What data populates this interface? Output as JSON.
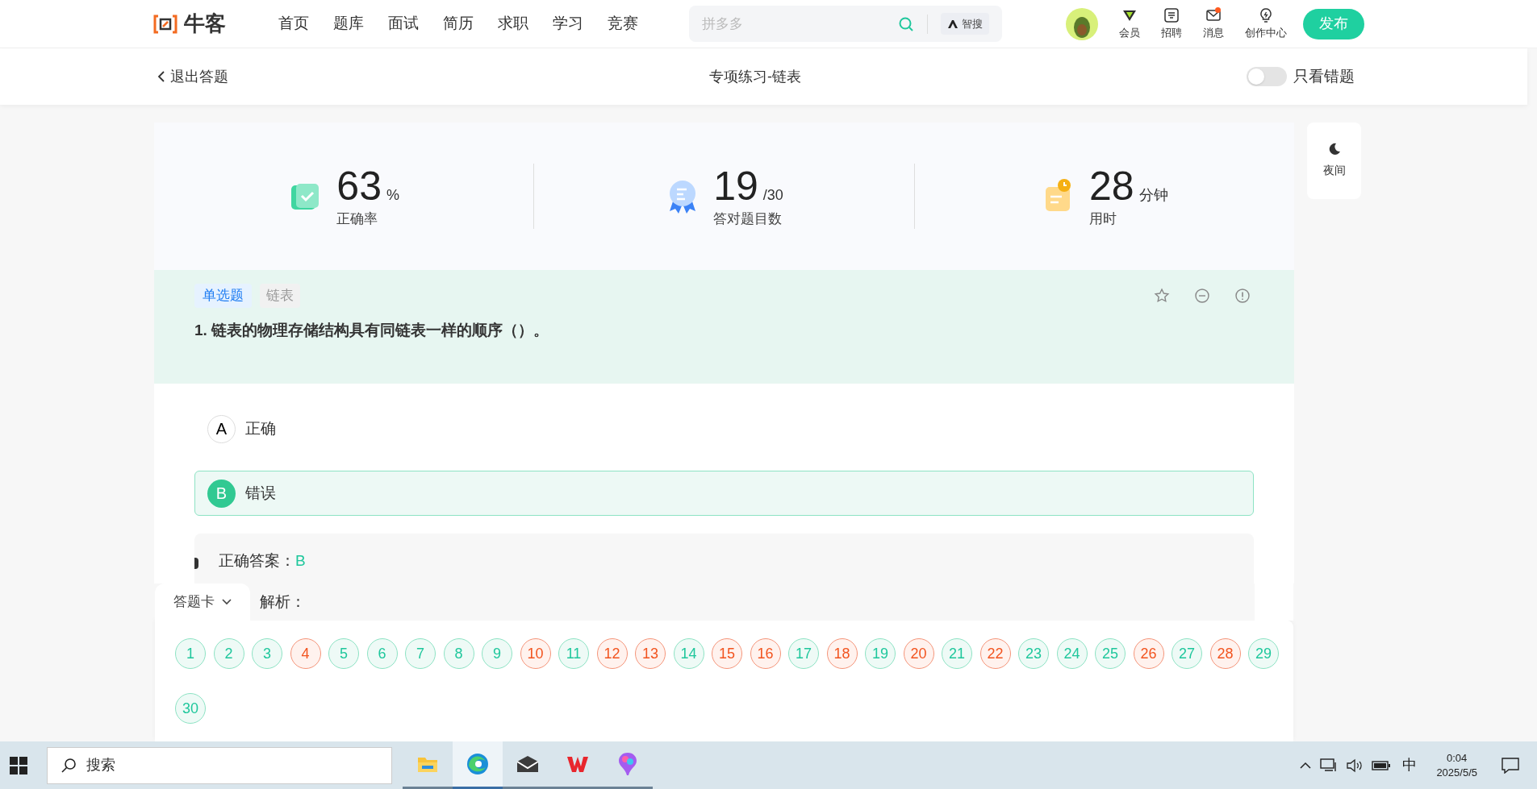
{
  "nav": {
    "logo": "牛客",
    "links": [
      "首页",
      "题库",
      "面试",
      "简历",
      "求职",
      "学习",
      "竞赛"
    ],
    "search": {
      "placeholder": "拼多多",
      "ai_label": "智搜"
    },
    "icons": [
      {
        "kind": "vip",
        "label": "会员",
        "badge": false
      },
      {
        "kind": "job",
        "label": "招聘",
        "badge": false
      },
      {
        "kind": "mail",
        "label": "消息",
        "badge": true
      },
      {
        "kind": "bulb",
        "label": "创作中心",
        "badge": false
      }
    ],
    "publish": "发布"
  },
  "subheader": {
    "back": "退出答题",
    "title": "专项练习-链表",
    "toggle": {
      "label": "只看错题",
      "on": false
    }
  },
  "stats": [
    {
      "kind": "book",
      "value": "63",
      "unit": "%",
      "label": "正确率"
    },
    {
      "kind": "medal",
      "value": "19",
      "unit": "/30",
      "label": "答对题目数"
    },
    {
      "kind": "clock",
      "value": "28",
      "unit": "分钟",
      "label": "用时"
    }
  ],
  "night": {
    "label": "夜间"
  },
  "question": {
    "type": "单选题",
    "tag": "链表",
    "text": "1. 链表的物理存储结构具有同链表一样的顺序（）。",
    "options": [
      {
        "letter": "A",
        "text": "正确",
        "selected": false
      },
      {
        "letter": "B",
        "text": "错误",
        "selected": true
      }
    ]
  },
  "answer": {
    "label": "正确答案：",
    "value": "B",
    "analysis": "解析："
  },
  "answer_card": {
    "title": "答题卡",
    "items": [
      {
        "label": "1",
        "correct": true
      },
      {
        "label": "2",
        "correct": true
      },
      {
        "label": "3",
        "correct": true
      },
      {
        "label": "4",
        "correct": false
      },
      {
        "label": "5",
        "correct": true
      },
      {
        "label": "6",
        "correct": true
      },
      {
        "label": "7",
        "correct": true
      },
      {
        "label": "8",
        "correct": true
      },
      {
        "label": "9",
        "correct": true
      },
      {
        "label": "10",
        "correct": false
      },
      {
        "label": "11",
        "correct": true
      },
      {
        "label": "12",
        "correct": false
      },
      {
        "label": "13",
        "correct": false
      },
      {
        "label": "14",
        "correct": true
      },
      {
        "label": "15",
        "correct": false
      },
      {
        "label": "16",
        "correct": false
      },
      {
        "label": "17",
        "correct": true
      },
      {
        "label": "18",
        "correct": false
      },
      {
        "label": "19",
        "correct": true
      },
      {
        "label": "20",
        "correct": false
      },
      {
        "label": "21",
        "correct": true
      },
      {
        "label": "22",
        "correct": false
      },
      {
        "label": "23",
        "correct": true
      },
      {
        "label": "24",
        "correct": true
      },
      {
        "label": "25",
        "correct": true
      },
      {
        "label": "26",
        "correct": false
      },
      {
        "label": "27",
        "correct": true
      },
      {
        "label": "28",
        "correct": false
      },
      {
        "label": "29",
        "correct": true
      },
      {
        "label": "30",
        "correct": true
      }
    ]
  },
  "taskbar": {
    "search": "搜索",
    "apps": [
      {
        "kind": "folder",
        "active": false
      },
      {
        "kind": "edge",
        "active": true
      },
      {
        "kind": "mail",
        "active": false
      },
      {
        "kind": "wps",
        "active": false
      },
      {
        "kind": "paint",
        "active": false
      }
    ],
    "ime": "中",
    "time": "0:04",
    "date": "2025/5/5"
  }
}
